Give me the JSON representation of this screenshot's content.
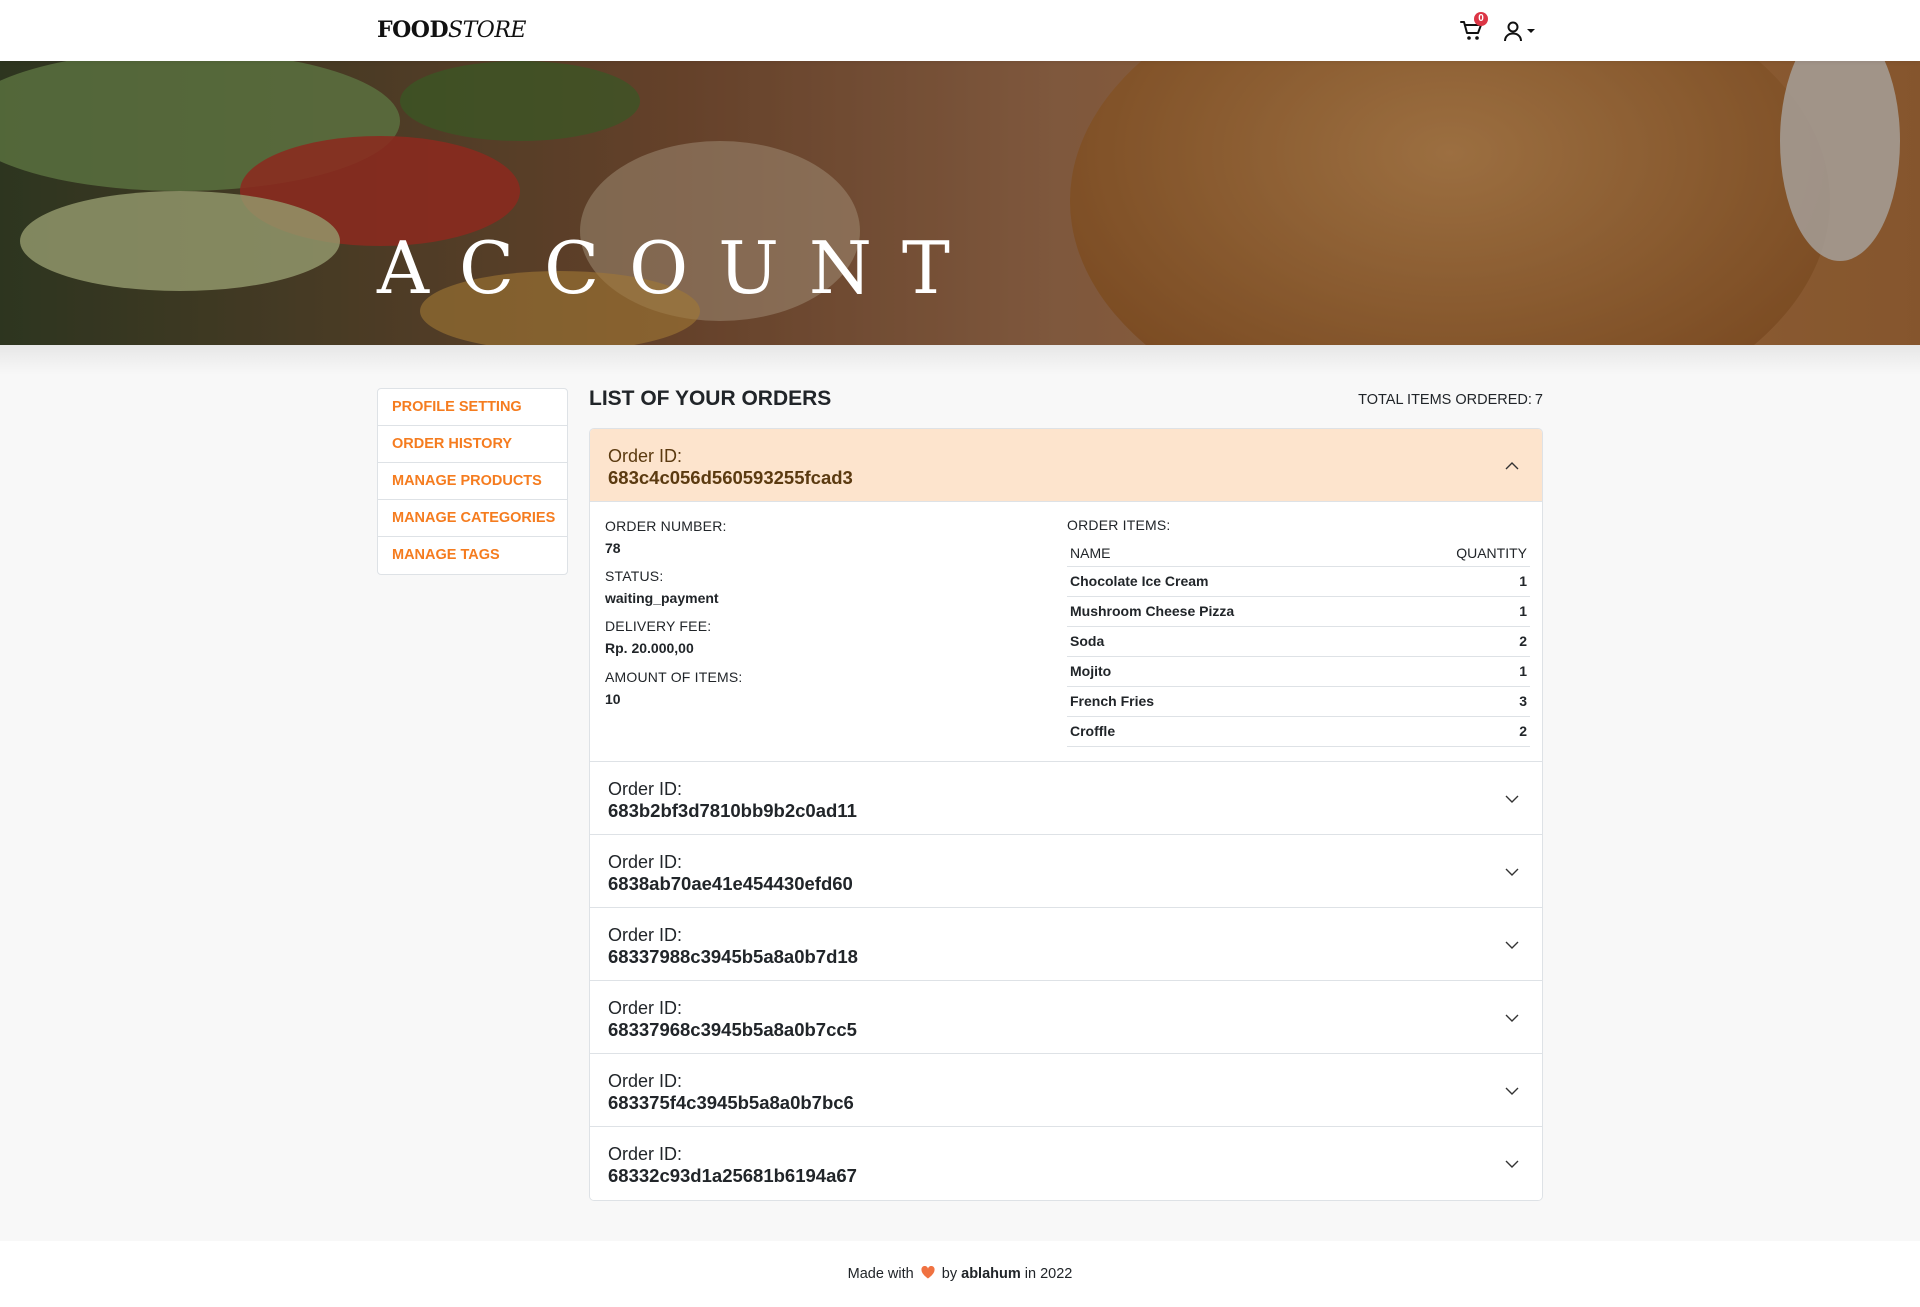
{
  "brand": {
    "bold": "FOOD",
    "italic": "STORE"
  },
  "cart": {
    "count": "0"
  },
  "hero": {
    "title": "ACCOUNT"
  },
  "sidebar": {
    "items": [
      {
        "label": "PROFILE SETTING"
      },
      {
        "label": "ORDER HISTORY"
      },
      {
        "label": "MANAGE PRODUCTS"
      },
      {
        "label": "MANAGE CATEGORIES"
      },
      {
        "label": "MANAGE TAGS"
      }
    ]
  },
  "main": {
    "title": "LIST OF YOUR ORDERS",
    "total_label": "TOTAL ITEMS ORDERED:",
    "total_value": "7",
    "order_id_label": "Order ID:"
  },
  "orders": [
    {
      "id": "683c4c056d560593255fcad3",
      "open": true
    },
    {
      "id": "683b2bf3d7810bb9b2c0ad11",
      "open": false
    },
    {
      "id": "6838ab70ae41e454430efd60",
      "open": false
    },
    {
      "id": "68337988c3945b5a8a0b7d18",
      "open": false
    },
    {
      "id": "68337968c3945b5a8a0b7cc5",
      "open": false
    },
    {
      "id": "683375f4c3945b5a8a0b7bc6",
      "open": false
    },
    {
      "id": "68332c93d1a25681b6194a67",
      "open": false
    }
  ],
  "detail": {
    "order_number_label": "ORDER NUMBER:",
    "order_number": "78",
    "status_label": "STATUS:",
    "status": "waiting_payment",
    "delivery_fee_label": "DELIVERY FEE:",
    "delivery_fee": "Rp. 20.000,00",
    "amount_label": "AMOUNT OF ITEMS:",
    "amount": "10",
    "items_label": "ORDER ITEMS:",
    "col_name": "NAME",
    "col_qty": "QUANTITY",
    "items": [
      {
        "name": "Chocolate Ice Cream",
        "qty": "1"
      },
      {
        "name": "Mushroom Cheese Pizza",
        "qty": "1"
      },
      {
        "name": "Soda",
        "qty": "2"
      },
      {
        "name": "Mojito",
        "qty": "1"
      },
      {
        "name": "French Fries",
        "qty": "3"
      },
      {
        "name": "Croffle",
        "qty": "2"
      }
    ]
  },
  "footer": {
    "made": "Made with",
    "by": "by",
    "author": "ablahum",
    "year": "in 2022"
  },
  "colors": {
    "accent": "#f57c1f",
    "open_header": "#fde4cd",
    "badge": "#dc3545",
    "heart": "#f07241"
  }
}
